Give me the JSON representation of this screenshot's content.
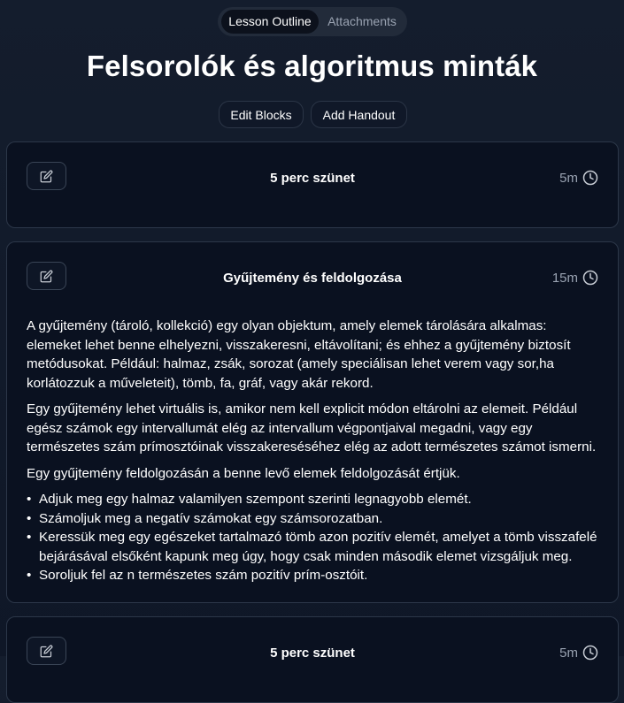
{
  "tabs": [
    {
      "label": "Lesson Outline",
      "active": true
    },
    {
      "label": "Attachments",
      "active": false
    }
  ],
  "page_title": "Felsorolók és algoritmus minták",
  "actions": {
    "edit_blocks": "Edit Blocks",
    "add_handout": "Add Handout"
  },
  "blocks": [
    {
      "title": "5 perc szünet",
      "duration": "5m"
    },
    {
      "title": "Gyűjtemény és feldolgozása",
      "duration": "15m",
      "paragraphs": [
        "A gyűjtemény (tároló, kollekció) egy olyan objektum, amely elemek tárolására alkalmas: elemeket lehet benne elhelyezni, visszakeresni, eltávolítani; és ehhez a gyűjtemény biztosít metódusokat. Például: halmaz, zsák, sorozat (amely speciálisan lehet verem vagy sor,ha korlátozzuk a műveleteit), tömb, fa, gráf, vagy akár rekord.",
        "Egy gyűjtemény lehet virtuális is, amikor nem kell explicit módon eltárolni az elemeit. Például egész számok egy intervallumát elég az intervallum végpontjaival megadni, vagy egy természetes szám prímosztóinak visszakereséséhez elég az adott természetes számot ismerni.",
        "Egy gyűjtemény feldolgozásán a benne levő elemek feldolgozását értjük."
      ],
      "bullets": [
        "Adjuk meg egy halmaz valamilyen szempont szerinti legnagyobb elemét.",
        "Számoljuk meg a negatív számokat egy számsorozatban.",
        "Keressük meg egy egészeket tartalmazó tömb azon pozitív elemét, amelyet a tömb visszafelé bejárásával elsőként kapunk meg úgy, hogy csak minden második elemet vizsgáljuk meg.",
        "Soroljuk fel az n természetes szám pozitív prím-osztóit."
      ]
    },
    {
      "title": "5 perc szünet",
      "duration": "5m"
    }
  ],
  "icons": {
    "edit": "pencil-square-icon",
    "duration": "clock-icon"
  },
  "colors": {
    "background": "#111a2a",
    "card": "#0a1120",
    "muted": "#9aa3b2"
  }
}
